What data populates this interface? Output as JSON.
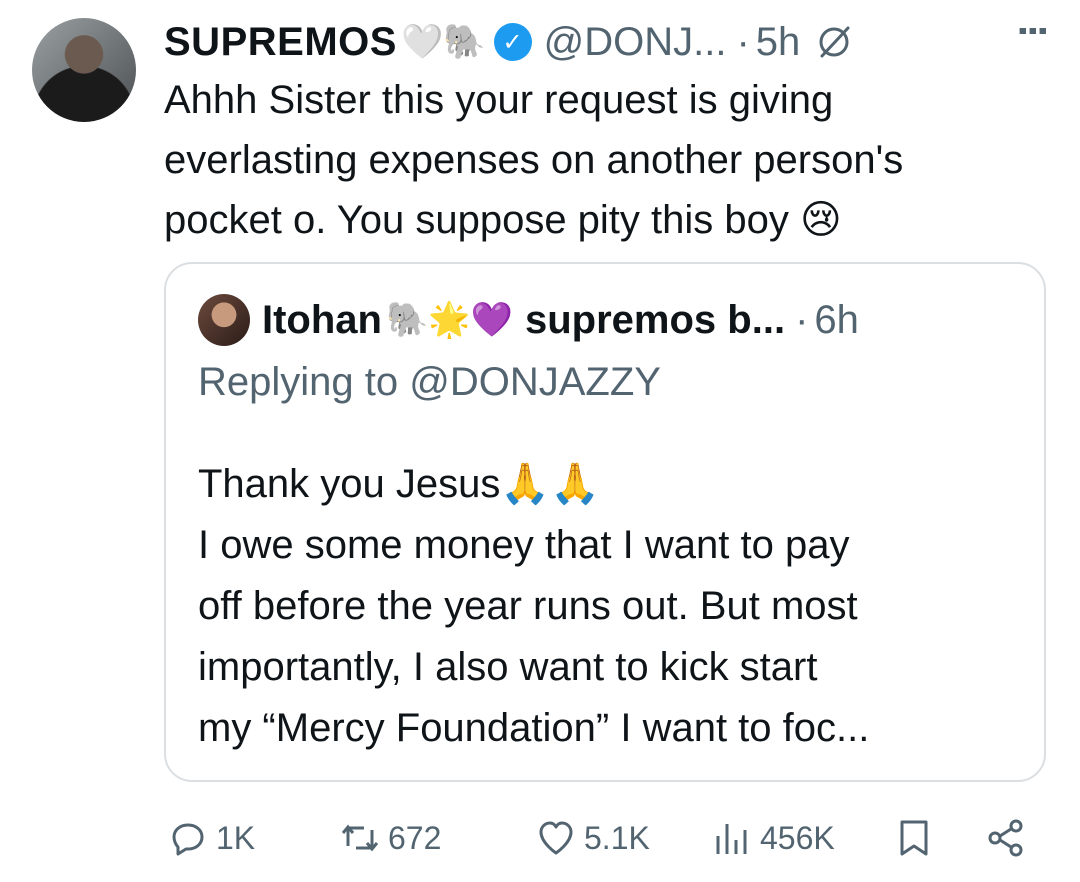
{
  "tweet": {
    "author_name": "SUPREMOS",
    "author_emojis": "🤍🐘",
    "handle": "@DONJ...",
    "separator": "·",
    "time": "5h",
    "text_lines": [
      "Ahhh Sister this your request is giving",
      "everlasting expenses on another person's",
      "pocket o. You suppose pity this boy 😢"
    ]
  },
  "quote": {
    "author_name": "Itohan",
    "author_emojis": "🐘🌟💜",
    "display2": "supremos b...",
    "separator": "·",
    "time": "6h",
    "replying_to": "Replying to @DONJAZZY",
    "body_lines": [
      "Thank you Jesus🙏🙏",
      "I owe some money that I want to pay",
      "off before the year runs out. But most",
      "importantly, I also want to kick start",
      "my “Mercy Foundation” I want to foc..."
    ]
  },
  "actions": {
    "replies": "1K",
    "reposts": "672",
    "likes": "5.1K",
    "views": "456K"
  },
  "colors": {
    "text": "#0f1419",
    "muted": "#536471",
    "verified": "#1d9bf0",
    "border": "#dcdfe2"
  }
}
